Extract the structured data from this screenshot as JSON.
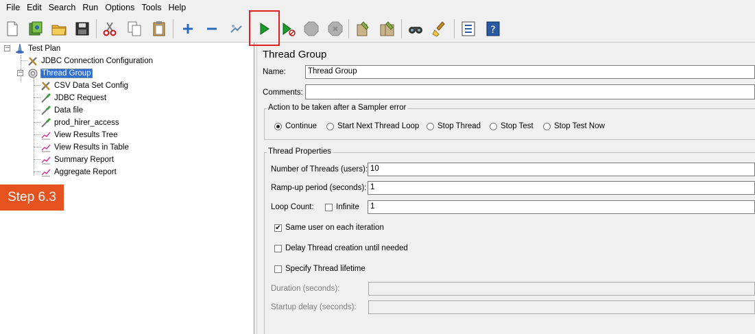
{
  "menu": [
    "File",
    "Edit",
    "Search",
    "Run",
    "Options",
    "Tools",
    "Help"
  ],
  "toolbar": {
    "buttons": [
      "new-icon",
      "templates-icon",
      "open-icon",
      "save-icon",
      "cut-icon",
      "copy-icon",
      "paste-icon",
      "expand-icon",
      "collapse-icon",
      "toggle-icon",
      "start-icon",
      "start-no-pause-icon",
      "stop-icon",
      "shutdown-icon",
      "clear-icon",
      "clear-all-icon",
      "search-icon",
      "reset-search-icon",
      "function-helper-icon",
      "help-icon"
    ]
  },
  "tree": {
    "items": [
      {
        "label": "Test Plan",
        "icon": "test-plan-icon"
      },
      {
        "label": "JDBC Connection Configuration",
        "icon": "config-element-icon"
      },
      {
        "label": "Thread Group",
        "icon": "thread-group-icon"
      },
      {
        "label": "CSV Data Set Config",
        "icon": "config-element-icon"
      },
      {
        "label": "JDBC Request",
        "icon": "sampler-icon"
      },
      {
        "label": "Data file",
        "icon": "sampler-icon"
      },
      {
        "label": "prod_hirer_access",
        "icon": "sampler-icon"
      },
      {
        "label": "View Results Tree",
        "icon": "listener-icon"
      },
      {
        "label": "View Results in Table",
        "icon": "listener-icon"
      },
      {
        "label": "Summary Report",
        "icon": "listener-icon"
      },
      {
        "label": "Aggregate Report",
        "icon": "listener-icon"
      }
    ]
  },
  "badge": "Step 6.3",
  "panel": {
    "title": "Thread Group",
    "name_label": "Name:",
    "name_value": "Thread Group",
    "comments_label": "Comments:",
    "comments_value": "",
    "error_action": {
      "legend": "Action to be taken after a Sampler error",
      "options": [
        "Continue",
        "Start Next Thread Loop",
        "Stop Thread",
        "Stop Test",
        "Stop Test Now"
      ],
      "selected": "Continue"
    },
    "thread_props": {
      "legend": "Thread Properties",
      "threads_label": "Number of Threads (users):",
      "threads_value": "10",
      "rampup_label": "Ramp-up period (seconds):",
      "rampup_value": "1",
      "loop_label": "Loop Count:",
      "infinite_label": "Infinite",
      "loop_value": "1",
      "same_user_label": "Same user on each iteration",
      "delay_label": "Delay Thread creation until needed",
      "lifetime_label": "Specify Thread lifetime",
      "duration_label": "Duration (seconds):",
      "startup_label": "Startup delay (seconds):"
    }
  },
  "colors": {
    "accent": "#2f6fd1",
    "badge": "#e4521f",
    "highlight": "#e02020",
    "start": "#1a9a2a"
  }
}
